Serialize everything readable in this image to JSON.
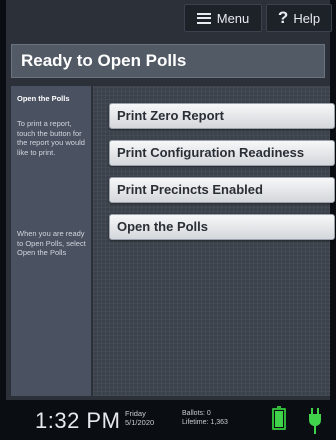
{
  "topbar": {
    "menu_label": "Menu",
    "help_label": "Help"
  },
  "page_title": "Ready to Open Polls",
  "sidebar": {
    "heading": "Open the Polls",
    "paragraph1": "To print a report, touch the button for the report you would like to print.",
    "paragraph2": "When you are ready to Open Polls, select Open the Polls"
  },
  "actions": [
    {
      "label": "Print Zero Report"
    },
    {
      "label": "Print Configuration Readiness"
    },
    {
      "label": "Print Precincts Enabled"
    },
    {
      "label": "Open the Polls"
    }
  ],
  "status": {
    "time": "1:32 PM",
    "day": "Friday",
    "date": "5/1/2020",
    "ballots_label": "Ballots:",
    "ballots_value": "0",
    "lifetime_label": "Lifetime:",
    "lifetime_value": "1,363"
  },
  "icons": {
    "menu": "hamburger-icon",
    "help": "question-icon",
    "battery": "battery-full-icon",
    "power": "power-plug-icon"
  },
  "colors": {
    "accent": "#525a66",
    "battery": "#3fd24a",
    "button_face": "#e8eaed"
  }
}
